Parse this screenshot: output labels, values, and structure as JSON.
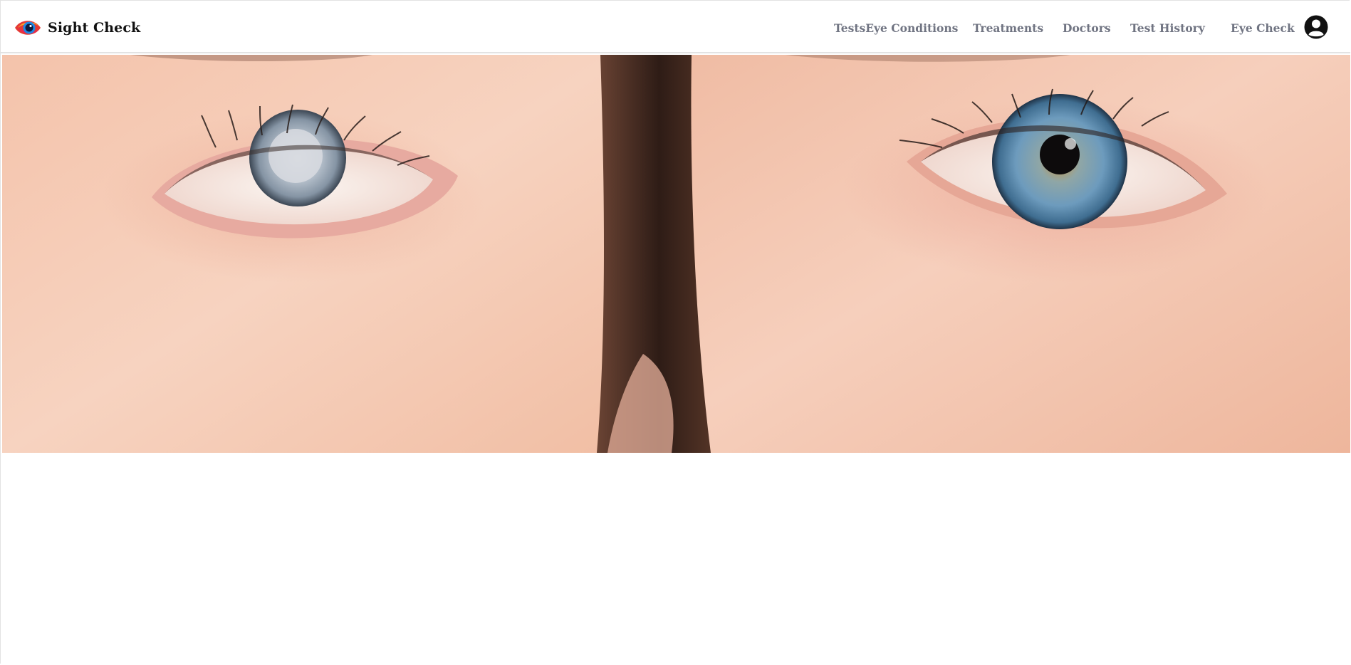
{
  "brand": {
    "name": "Sight Check",
    "logo_icon": "eye-logo-icon"
  },
  "nav": {
    "items": [
      {
        "label": "TestsEye Conditions"
      },
      {
        "label": "Treatments"
      },
      {
        "label": "Doctors"
      },
      {
        "label": "Test History"
      },
      {
        "label": "Eye Check"
      }
    ],
    "account_icon": "user-circle-icon"
  },
  "hero": {
    "image": "close-up-eyes-comparison-photo",
    "left_eye": "cloudy-cataract-eye",
    "right_eye": "healthy-blue-eye"
  },
  "colors": {
    "nav_text": "#707482",
    "brand_text": "#111111",
    "skin_tone": "#f2c2aa",
    "iris_left": "#a6b3c1",
    "iris_right": "#5f8fb2"
  }
}
